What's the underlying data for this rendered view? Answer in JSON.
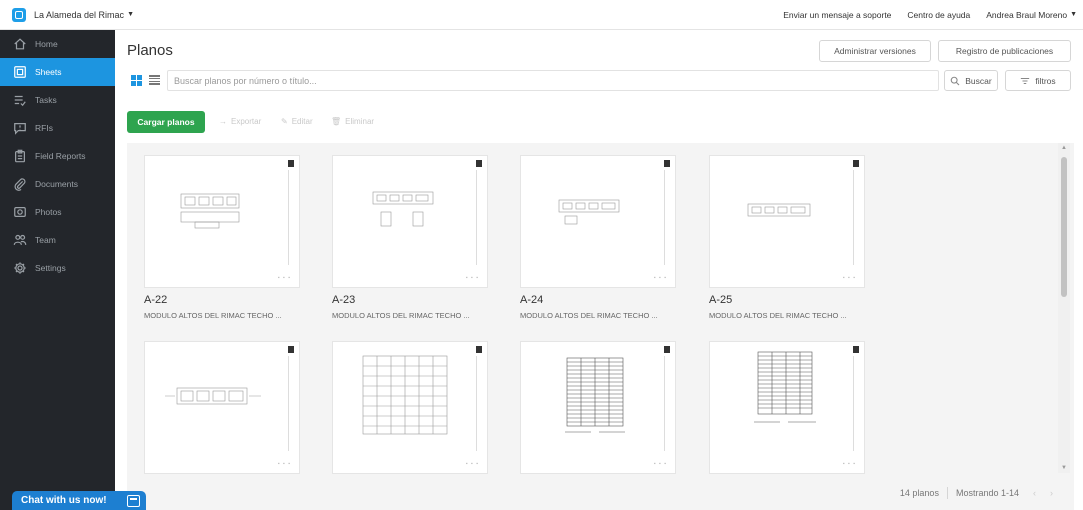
{
  "topbar": {
    "project_name": "La Alameda del Rimac",
    "support_link": "Enviar un mensaje a soporte",
    "help_link": "Centro de ayuda",
    "user_name": "Andrea Braul Moreno"
  },
  "sidebar": {
    "items": [
      {
        "label": "Home",
        "icon": "home-icon"
      },
      {
        "label": "Sheets",
        "icon": "sheets-icon",
        "active": true
      },
      {
        "label": "Tasks",
        "icon": "tasks-icon"
      },
      {
        "label": "RFIs",
        "icon": "rfi-icon"
      },
      {
        "label": "Field Reports",
        "icon": "clipboard-icon"
      },
      {
        "label": "Documents",
        "icon": "paperclip-icon"
      },
      {
        "label": "Photos",
        "icon": "camera-icon"
      },
      {
        "label": "Team",
        "icon": "team-icon"
      },
      {
        "label": "Settings",
        "icon": "gear-icon"
      }
    ]
  },
  "main": {
    "title": "Planos",
    "manage_versions": "Administrar versiones",
    "publication_log": "Registro de publicaciones",
    "search_placeholder": "Buscar planos por número o título...",
    "search_button": "Buscar",
    "filters_button": "filtros",
    "upload_button": "Cargar planos",
    "actions": [
      "Exportar",
      "Editar",
      "Eliminar"
    ]
  },
  "sheets": [
    {
      "code": "A-22",
      "desc": "MODULO ALTOS DEL RIMAC TECHO ..."
    },
    {
      "code": "A-23",
      "desc": "MODULO ALTOS DEL RIMAC TECHO ..."
    },
    {
      "code": "A-24",
      "desc": "MODULO ALTOS DEL RIMAC TECHO ..."
    },
    {
      "code": "A-25",
      "desc": "MODULO ALTOS DEL RIMAC TECHO ..."
    },
    {
      "code": "",
      "desc": ""
    },
    {
      "code": "",
      "desc": ""
    },
    {
      "code": "",
      "desc": ""
    },
    {
      "code": "",
      "desc": ""
    }
  ],
  "footer": {
    "count": "14 planos",
    "range": "Mostrando 1-14"
  },
  "chat": {
    "label": "Chat with us now!"
  },
  "colors": {
    "accent": "#1d95e0",
    "sidebar_bg": "#23262b",
    "upload_green": "#2ea44f"
  }
}
